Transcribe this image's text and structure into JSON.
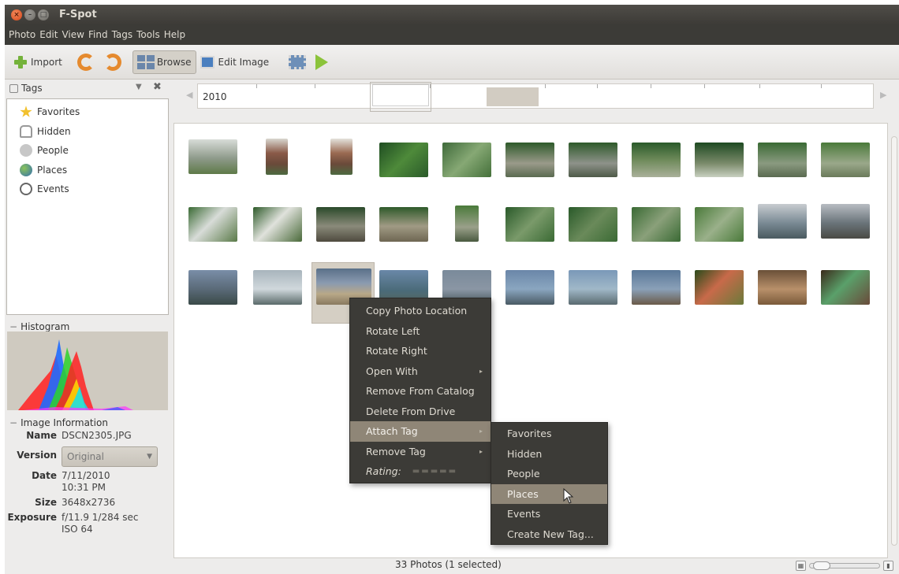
{
  "window": {
    "title": "F-Spot"
  },
  "menubar": [
    "Photo",
    "Edit",
    "View",
    "Find",
    "Tags",
    "Tools",
    "Help"
  ],
  "toolbar": {
    "import": "Import",
    "browse": "Browse",
    "edit_image": "Edit Image"
  },
  "tags_panel": {
    "title": "Tags",
    "items": [
      "Favorites",
      "Hidden",
      "People",
      "Places",
      "Events"
    ]
  },
  "histogram": {
    "title": "Histogram"
  },
  "image_info": {
    "title": "Image Information",
    "name_label": "Name",
    "name": "DSCN2305.JPG",
    "version_label": "Version",
    "version": "Original",
    "date_label": "Date",
    "date": "7/11/2010",
    "time": "10:31 PM",
    "size_label": "Size",
    "size": "3648x2736",
    "exposure_label": "Exposure",
    "exposure": "f/11.9 1/284 sec",
    "iso": "ISO 64"
  },
  "timeline": {
    "year": "2010"
  },
  "status": "33 Photos (1 selected)",
  "context_menu": {
    "items": [
      "Copy Photo Location",
      "Rotate Left",
      "Rotate Right",
      "Open With",
      "Remove From Catalog",
      "Delete From Drive",
      "Attach Tag",
      "Remove Tag",
      "Rating:"
    ]
  },
  "submenu": {
    "items": [
      "Favorites",
      "Hidden",
      "People",
      "Places",
      "Events",
      "Create New Tag..."
    ]
  },
  "icons": [
    "close-icon",
    "minimize-icon",
    "maximize-icon",
    "import-icon",
    "rotate-left-icon",
    "rotate-right-icon",
    "browse-icon",
    "edit-image-icon",
    "fullscreen-icon",
    "slideshow-icon"
  ]
}
